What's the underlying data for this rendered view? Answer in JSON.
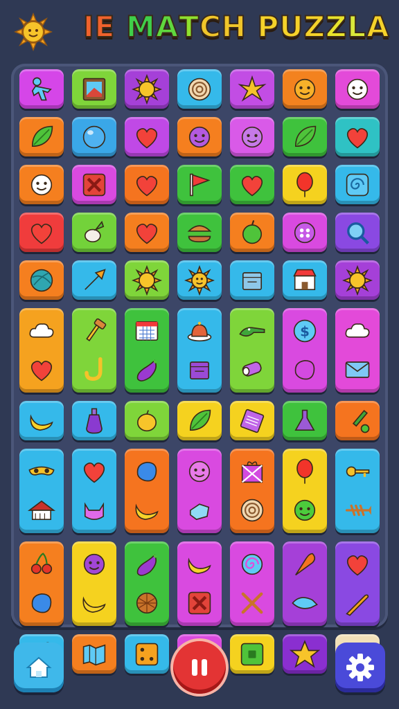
{
  "header": {
    "title_parts": [
      {
        "text": "I",
        "color": "#f0622c"
      },
      {
        "text": "E",
        "color": "#f0622c"
      },
      {
        "text": " ",
        "color": "#ffffff"
      },
      {
        "text": "M",
        "color": "#3fcf4a"
      },
      {
        "text": "A",
        "color": "#5fd83e"
      },
      {
        "text": "T",
        "color": "#8fe02e"
      },
      {
        "text": "C",
        "color": "#f0c52a"
      },
      {
        "text": "H",
        "color": "#f0c52a"
      },
      {
        "text": " ",
        "color": "#ffffff"
      },
      {
        "text": "P",
        "color": "#f5d22a"
      },
      {
        "text": "U",
        "color": "#f5d22a"
      },
      {
        "text": "Z",
        "color": "#f5d22a"
      },
      {
        "text": "Z",
        "color": "#e8e32c"
      },
      {
        "text": "L",
        "color": "#d9e83a"
      },
      {
        "text": "A",
        "color": "#f5d22a"
      }
    ],
    "logo_icon": "sun-icon"
  },
  "board": {
    "tiles": [
      {
        "color": "#d546e8",
        "icon": "person-icon",
        "span": 1
      },
      {
        "color": "#7fd53a",
        "icon": "picture-frame-icon",
        "span": 1
      },
      {
        "color": "#a540d8",
        "icon": "sun-icon",
        "span": 1
      },
      {
        "color": "#35b9ea",
        "icon": "spiral-disc-icon",
        "span": 1
      },
      {
        "color": "#c24de4",
        "icon": "starfish-icon",
        "span": 1
      },
      {
        "color": "#f3821f",
        "icon": "smiley-face-icon",
        "span": 1
      },
      {
        "color": "#e34ad9",
        "icon": "snowman-face-icon",
        "span": 1
      },
      {
        "color": "#f57f1f",
        "icon": "leaves-icon",
        "span": 1
      },
      {
        "color": "#3aa7e8",
        "icon": "blue-bubble-icon",
        "span": 1
      },
      {
        "color": "#c049e6",
        "icon": "heart-icon",
        "span": 1
      },
      {
        "color": "#f57f1f",
        "icon": "purple-blob-face-icon",
        "span": 1
      },
      {
        "color": "#d95ae8",
        "icon": "cloud-face-icon",
        "span": 1
      },
      {
        "color": "#3fc23d",
        "icon": "leaf-icon",
        "span": 1
      },
      {
        "color": "#2fc2c4",
        "icon": "heart-icon",
        "span": 1
      },
      {
        "color": "#f57f1f",
        "icon": "ghost-face-icon",
        "span": 1
      },
      {
        "color": "#d94ae0",
        "icon": "x-mark-icon",
        "span": 1
      },
      {
        "color": "#f5741f",
        "icon": "heart-icon",
        "span": 1
      },
      {
        "color": "#3fc23d",
        "icon": "flag-icon",
        "span": 1
      },
      {
        "color": "#3fc23d",
        "icon": "heart-icon",
        "span": 1
      },
      {
        "color": "#f5d21f",
        "icon": "balloon-icon",
        "span": 1
      },
      {
        "color": "#35b9ea",
        "icon": "swirl-icon",
        "span": 1
      },
      {
        "color": "#f03c3c",
        "icon": "heart-icon",
        "span": 1
      },
      {
        "color": "#73d23a",
        "icon": "radish-icon",
        "span": 1
      },
      {
        "color": "#f57f1f",
        "icon": "heart-icon",
        "span": 1
      },
      {
        "color": "#3fc23d",
        "icon": "burger-icon",
        "span": 1
      },
      {
        "color": "#f57f1f",
        "icon": "apple-icon",
        "span": 1
      },
      {
        "color": "#d94ae0",
        "icon": "button-icon",
        "span": 1
      },
      {
        "color": "#8a49e2",
        "icon": "magnifier-icon",
        "span": 1
      },
      {
        "color": "#f57f1f",
        "icon": "yarn-ball-icon",
        "span": 1
      },
      {
        "color": "#35b9ea",
        "icon": "arrow-icon",
        "span": 1
      },
      {
        "color": "#7fd53a",
        "icon": "sun-icon",
        "span": 1
      },
      {
        "color": "#35b9ea",
        "icon": "sun-face-icon",
        "span": 1
      },
      {
        "color": "#35b9ea",
        "icon": "box-icon",
        "span": 1
      },
      {
        "color": "#35b9ea",
        "icon": "shop-icon",
        "span": 1
      },
      {
        "color": "#a540d8",
        "icon": "sun-icon",
        "span": 1
      },
      {
        "color": "#f5a21f",
        "icon": "cloud-icon",
        "span": 2,
        "icon2": "heart-icon"
      },
      {
        "color": "#7fd53a",
        "icon": "hammer-icon",
        "span": 2,
        "icon2": "hook-icon"
      },
      {
        "color": "#3fc23d",
        "icon": "calendar-icon",
        "span": 2,
        "icon2": "eggplant-icon"
      },
      {
        "color": "#35b9ea",
        "icon": "bell-plate-icon",
        "span": 2,
        "icon2": "purple-box-icon"
      },
      {
        "color": "#7fd53a",
        "icon": "crocodile-icon",
        "span": 2,
        "icon2": "tube-icon"
      },
      {
        "color": "#d94ae0",
        "icon": "dollar-coin-icon",
        "span": 2,
        "icon2": "purple-blob-icon"
      },
      {
        "color": "#e34ad9",
        "icon": "cloud-icon",
        "span": 2,
        "icon2": "envelope-icon"
      },
      {
        "color": "#35b9ea",
        "icon": "banana-icon",
        "span": 1
      },
      {
        "color": "#35b9ea",
        "icon": "potion-icon",
        "span": 1
      },
      {
        "color": "#7fd53a",
        "icon": "lemon-icon",
        "span": 1
      },
      {
        "color": "#f5d21f",
        "icon": "leaf-icon",
        "span": 1
      },
      {
        "color": "#f5d21f",
        "icon": "note-icon",
        "span": 1
      },
      {
        "color": "#3fc23d",
        "icon": "flask-icon",
        "span": 1
      },
      {
        "color": "#f5741f",
        "icon": "brush-icon",
        "span": 1
      },
      {
        "color": "#35b9ea",
        "icon": "mask-icon",
        "span": 2,
        "icon2": "house-icon"
      },
      {
        "color": "#35b9ea",
        "icon": "heart-icon",
        "span": 2,
        "icon2": "cat-icon"
      },
      {
        "color": "#f5741f",
        "icon": "blue-blob-icon",
        "span": 2,
        "icon2": "banana-icon"
      },
      {
        "color": "#d94ae0",
        "icon": "blob-face-icon",
        "span": 2,
        "icon2": "ice-cube-icon"
      },
      {
        "color": "#f5741f",
        "icon": "gift-box-icon",
        "span": 2,
        "icon2": "spiral-disc-icon"
      },
      {
        "color": "#f5d21f",
        "icon": "balloon-icon",
        "span": 2,
        "icon2": "green-face-icon"
      },
      {
        "color": "#35b9ea",
        "icon": "key-icon",
        "span": 2,
        "icon2": "fish-bone-icon"
      },
      {
        "color": "#f57f1f",
        "icon": "cherry-icon",
        "span": 2,
        "icon2": "blue-blob-icon"
      },
      {
        "color": "#f5d21f",
        "icon": "purple-face-icon",
        "span": 2,
        "icon2": "banana-icon"
      },
      {
        "color": "#3fc23d",
        "icon": "eggplant-icon",
        "span": 2,
        "icon2": "waffle-icon"
      },
      {
        "color": "#d94ae0",
        "icon": "banana-icon",
        "span": 2,
        "icon2": "x-mark-icon"
      },
      {
        "color": "#d94ae0",
        "icon": "swirl-lolly-icon",
        "span": 2,
        "icon2": "crossed-sticks-icon"
      },
      {
        "color": "#a540d8",
        "icon": "carrot-icon",
        "span": 2,
        "icon2": "blue-wing-icon"
      },
      {
        "color": "#8a49e2",
        "icon": "heart-icon",
        "span": 2,
        "icon2": "horn-icon"
      },
      {
        "color": "#35b9ea",
        "icon": "magic-wand-icon",
        "span": 1
      },
      {
        "color": "#f57f1f",
        "icon": "map-icon",
        "span": 1
      },
      {
        "color": "#35b9ea",
        "icon": "dice-icon",
        "span": 1
      },
      {
        "color": "#d94ae0",
        "icon": "cracked-box-icon",
        "span": 1
      },
      {
        "color": "#f5d21f",
        "icon": "green-square-icon",
        "span": 1
      },
      {
        "color": "#8a2fd0",
        "icon": "star-icon",
        "span": 1
      },
      {
        "color": "#f2e0b8",
        "icon": "ring-icon",
        "span": 1
      }
    ]
  },
  "controls": {
    "home_icon": "home-icon",
    "pause_icon": "pause-icon",
    "settings_icon": "gear-icon"
  }
}
